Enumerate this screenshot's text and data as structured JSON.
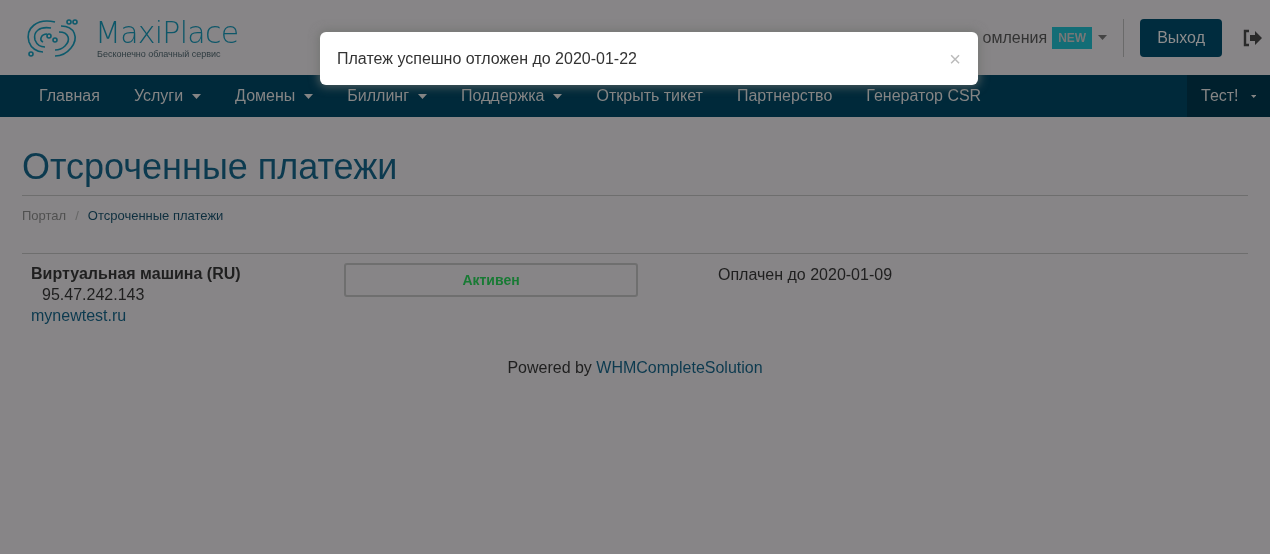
{
  "header": {
    "logo_name": "MaxiPlace",
    "logo_tagline": "Бесконечно облачный сервис",
    "notifications_visible": "омления",
    "notifications_badge": "NEW",
    "logout_button": "Выход"
  },
  "nav": {
    "items": [
      {
        "label": "Главная",
        "dropdown": false
      },
      {
        "label": "Услуги",
        "dropdown": true
      },
      {
        "label": "Домены",
        "dropdown": true
      },
      {
        "label": "Биллинг",
        "dropdown": true
      },
      {
        "label": "Поддержка",
        "dropdown": true
      },
      {
        "label": "Открыть тикет",
        "dropdown": false
      },
      {
        "label": "Партнерство",
        "dropdown": false
      },
      {
        "label": "Генератор CSR",
        "dropdown": false
      }
    ],
    "account": {
      "label": "Тест!",
      "dropdown": true
    }
  },
  "toast": {
    "message": "Платеж успешно отложен до 2020-01-22",
    "close": "×"
  },
  "page_title": "Отсроченные платежи",
  "breadcrumb_separator": "/",
  "breadcrumb": [
    {
      "label": "Портал",
      "selected": false
    },
    {
      "label": "Отсроченные платежи",
      "selected": true
    }
  ],
  "services": [
    {
      "name": "Виртуальная машина (RU)",
      "ip": "95.47.242.143",
      "domain": "mynewtest.ru",
      "status": "Активен",
      "paid_until": "Оплачен до 2020-01-09"
    }
  ],
  "footer": {
    "prefix": "Powered by",
    "link": "WHMCompleteSolution"
  }
}
